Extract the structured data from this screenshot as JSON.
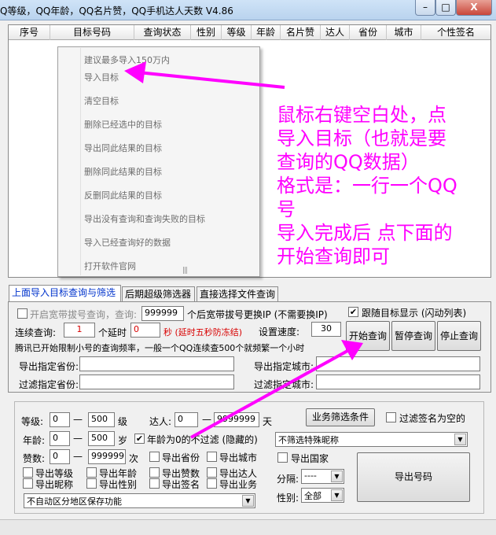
{
  "window": {
    "title": "Q等级，QQ年龄，QQ名片赞，QQ手机达人天数  V4.86",
    "min": "–",
    "max": "□",
    "close": "X"
  },
  "columns": [
    "序号",
    "目标号码",
    "查询状态",
    "性别",
    "等级",
    "年龄",
    "名片赞",
    "达人",
    "省份",
    "城市",
    "个性签名"
  ],
  "context_menu": [
    "建议最多导入150万内",
    "导入目标",
    "清空目标",
    "删除已经选中的目标",
    "导出同此结果的目标",
    "删除同此结果的目标",
    "反删同此结果的目标",
    "导出没有查询和查询失败的目标",
    "导入已经查询好的数据",
    "打开软件官网"
  ],
  "context_grip": "|||",
  "annotation": [
    "鼠标右键空白处，点",
    "导入目标（也就是要",
    "查询的QQ数据）",
    "格式是：一行一个QQ",
    "号",
    "导入完成后 点下面的",
    "开始查询即可"
  ],
  "tabs": [
    "上面导入目标查询与筛选",
    "后期超级筛选器",
    "直接选择文件查询"
  ],
  "broadband": {
    "label": "开启宽带拔号查询，查询:",
    "value": "999999",
    "suffix": "个后宽带拔号更换IP (不需要换IP)"
  },
  "follow": {
    "label": "跟随目标显示 (闪动列表)",
    "checked": "✔"
  },
  "continuous": {
    "label": "连续查询:",
    "count": "1",
    "delay_label": "个延时",
    "delay": "0",
    "unit": "秒 (延时五秒防冻结)",
    "speed_label": "设置速度:",
    "speed": "30"
  },
  "buttons": {
    "start": "开始查询",
    "pause": "暂停查询",
    "stop": "停止查询",
    "filter": "业务筛选条件",
    "export": "导出号码"
  },
  "notice": "腾讯已开始限制小号的查询频率，一般一个QQ连续查500个就频繁一个小时",
  "export_province": "导出指定省份:",
  "export_city": "导出指定城市:",
  "filter_province": "过滤指定省份:",
  "filter_city": "过滤指定城市:",
  "level": {
    "label": "等级:",
    "min": "0",
    "max": "500",
    "unit": "级"
  },
  "talent": {
    "label": "达人:",
    "min": "0",
    "max": "9999999",
    "unit": "天"
  },
  "age": {
    "label": "年龄:",
    "min": "0",
    "max": "500",
    "unit": "岁"
  },
  "age_zero": {
    "label": "年龄为0的不过滤 (隐藏的)",
    "checked": "✔"
  },
  "likes": {
    "label": "赞数:",
    "min": "0",
    "max": "999999",
    "unit": "次"
  },
  "dash": "—",
  "filter_empty_sign": "过滤签名为空的",
  "nickname_select": "不筛选特殊昵称",
  "export_country": "导出国家",
  "sep": {
    "label": "分隔:",
    "value": "----"
  },
  "gender": {
    "label": "性别:",
    "value": "全部"
  },
  "checks": [
    "导出等级",
    "导出年龄",
    "导出赞数",
    "导出达人",
    "导出昵称",
    "导出性别",
    "导出签名",
    "导出业务"
  ],
  "check_province": "导出省份",
  "check_city": "导出城市",
  "region_select": "不自动区分地区保存功能",
  "arrow": "▼"
}
